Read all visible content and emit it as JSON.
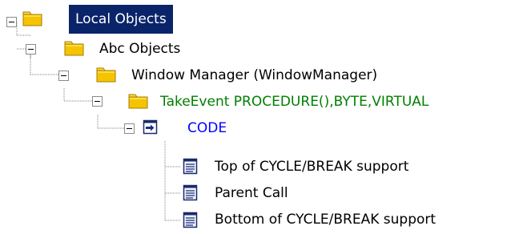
{
  "tree": {
    "nodes": [
      {
        "label": "Local Objects",
        "icon": "folder-icon",
        "color": "#ffffff",
        "selected": true,
        "selected_bg": "#0a246a"
      },
      {
        "label": "Abc Objects",
        "icon": "folder-icon",
        "color": "#000000"
      },
      {
        "label": "Window Manager (WindowManager)",
        "icon": "folder-icon",
        "color": "#000000"
      },
      {
        "label": "TakeEvent PROCEDURE(),BYTE,VIRTUAL",
        "icon": "folder-icon",
        "color": "#008000"
      },
      {
        "label": "CODE",
        "icon": "code-entry-icon",
        "color": "#0000ff"
      },
      {
        "label": "Top of CYCLE/BREAK support",
        "icon": "document-icon",
        "color": "#000000"
      },
      {
        "label": "Parent Call",
        "icon": "document-icon",
        "color": "#000000"
      },
      {
        "label": "Bottom of CYCLE/BREAK support",
        "icon": "document-icon",
        "color": "#000000"
      }
    ]
  }
}
